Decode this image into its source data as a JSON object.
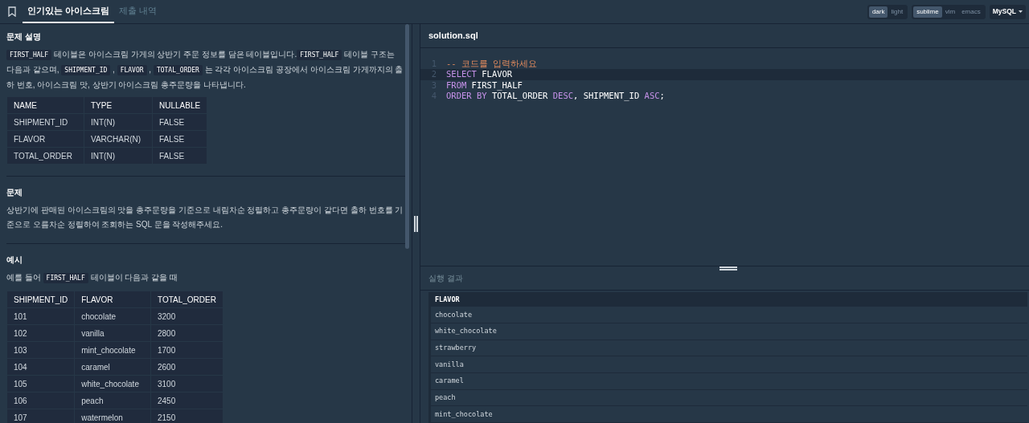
{
  "tabs": [
    {
      "label": "인기있는 아이스크림",
      "selected": true
    },
    {
      "label": "제출 내역",
      "selected": false
    }
  ],
  "toolbar": {
    "themes": [
      {
        "label": "dark",
        "selected": true
      },
      {
        "label": "light",
        "selected": false
      }
    ],
    "keymaps": [
      {
        "label": "sublime",
        "selected": true
      },
      {
        "label": "vim",
        "selected": false
      },
      {
        "label": "emacs",
        "selected": false
      }
    ],
    "language": "MySQL"
  },
  "sections": [
    {
      "heading": "문제 설명",
      "paragraphs": [
        [
          {
            "kind": "code",
            "text": "FIRST_HALF"
          },
          {
            "kind": "text",
            "text": " 테이블은 아이스크림 가게의 상반기 주문 정보를 담은 테이블입니다."
          },
          {
            "kind": "code",
            "text": "FIRST_HALF"
          },
          {
            "kind": "text",
            "text": " 테이블 구조는 다음과 같으며, "
          },
          {
            "kind": "code",
            "text": "SHIPMENT_ID"
          },
          {
            "kind": "text",
            "text": " , "
          },
          {
            "kind": "code",
            "text": "FLAVOR"
          },
          {
            "kind": "text",
            "text": " , "
          },
          {
            "kind": "code",
            "text": "TOTAL_ORDER"
          },
          {
            "kind": "text",
            "text": " 는 각각 아이스크림 공장에서 아이스크림 가게까지의 출하 번호, 아이스크림 맛, 상반기 아이스크림 총주문량을 나타냅니다."
          }
        ]
      ],
      "table": {
        "columns": [
          "NAME",
          "TYPE",
          "NULLABLE"
        ],
        "rows": [
          [
            "SHIPMENT_ID",
            "INT(N)",
            "FALSE"
          ],
          [
            "FLAVOR",
            "VARCHAR(N)",
            "FALSE"
          ],
          [
            "TOTAL_ORDER",
            "INT(N)",
            "FALSE"
          ]
        ]
      }
    },
    {
      "heading": "문제",
      "paragraphs": [
        [
          {
            "kind": "text",
            "text": "상반기에 판매된 아이스크림의 맛을 총주문량을 기준으로 내림차순 정렬하고 총주문량이 같다면 출하 번호를 기준으로 오름차순 정렬하여 조회하는 SQL 문을 작성해주세요."
          }
        ]
      ]
    },
    {
      "heading": "예시",
      "paragraphs": [
        [
          {
            "kind": "text",
            "text": "예를 들어 "
          },
          {
            "kind": "code",
            "text": "FIRST_HALF"
          },
          {
            "kind": "text",
            "text": " 테이블이 다음과 같을 때"
          }
        ]
      ],
      "table": {
        "columns": [
          "SHIPMENT_ID",
          "FLAVOR",
          "TOTAL_ORDER"
        ],
        "rows": [
          [
            "101",
            "chocolate",
            "3200"
          ],
          [
            "102",
            "vanilla",
            "2800"
          ],
          [
            "103",
            "mint_chocolate",
            "1700"
          ],
          [
            "104",
            "caramel",
            "2600"
          ],
          [
            "105",
            "white_chocolate",
            "3100"
          ],
          [
            "106",
            "peach",
            "2450"
          ],
          [
            "107",
            "watermelon",
            "2150"
          ]
        ]
      }
    }
  ],
  "editor": {
    "filename": "solution.sql",
    "lines": [
      {
        "number": "1",
        "active": false,
        "tokens": [
          {
            "kind": "comment",
            "text": "-- 코드를 입력하세요"
          }
        ]
      },
      {
        "number": "2",
        "active": true,
        "tokens": [
          {
            "kind": "keyword",
            "text": "SELECT"
          },
          {
            "kind": "plain",
            "text": " FLAVOR"
          }
        ]
      },
      {
        "number": "3",
        "active": false,
        "tokens": [
          {
            "kind": "keyword",
            "text": "FROM"
          },
          {
            "kind": "plain",
            "text": " FIRST_HALF"
          }
        ]
      },
      {
        "number": "4",
        "active": false,
        "tokens": [
          {
            "kind": "keyword",
            "text": "ORDER BY"
          },
          {
            "kind": "plain",
            "text": " TOTAL_ORDER "
          },
          {
            "kind": "keyword",
            "text": "DESC"
          },
          {
            "kind": "plain",
            "text": ", SHIPMENT_ID "
          },
          {
            "kind": "keyword",
            "text": "ASC"
          },
          {
            "kind": "plain",
            "text": ";"
          }
        ]
      }
    ]
  },
  "results": {
    "title": "실행 결과",
    "columns": [
      "FLAVOR"
    ],
    "rows": [
      [
        "chocolate"
      ],
      [
        "white_chocolate"
      ],
      [
        "strawberry"
      ],
      [
        "vanilla"
      ],
      [
        "caramel"
      ],
      [
        "peach"
      ],
      [
        "mint_chocolate"
      ]
    ]
  }
}
